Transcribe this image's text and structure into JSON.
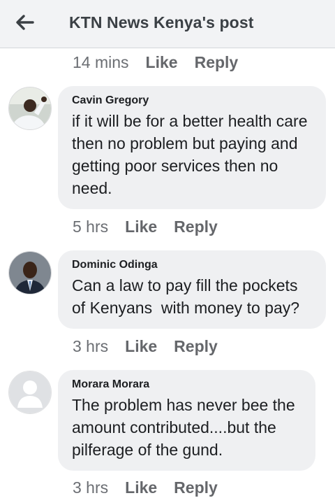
{
  "header": {
    "title": "KTN News Kenya's post",
    "back_icon": "arrow-left-icon"
  },
  "top_meta": {
    "time": "14 mins",
    "like": "Like",
    "reply": "Reply"
  },
  "comments": [
    {
      "author": "Cavin Gregory",
      "text": "if it will be for a better health care then no problem but paying and getting poor services then no need.",
      "time": "5 hrs",
      "like": "Like",
      "reply": "Reply"
    },
    {
      "author": "Dominic Odinga",
      "text": "Can a law to pay fill the pockets of Kenyans  with money to pay?",
      "time": "3 hrs",
      "like": "Like",
      "reply": "Reply"
    },
    {
      "author": "Morara Morara",
      "text": "The problem has never bee the amount contributed....but the pilferage of the gund.",
      "time": "3 hrs",
      "like": "Like",
      "reply": "Reply"
    }
  ]
}
